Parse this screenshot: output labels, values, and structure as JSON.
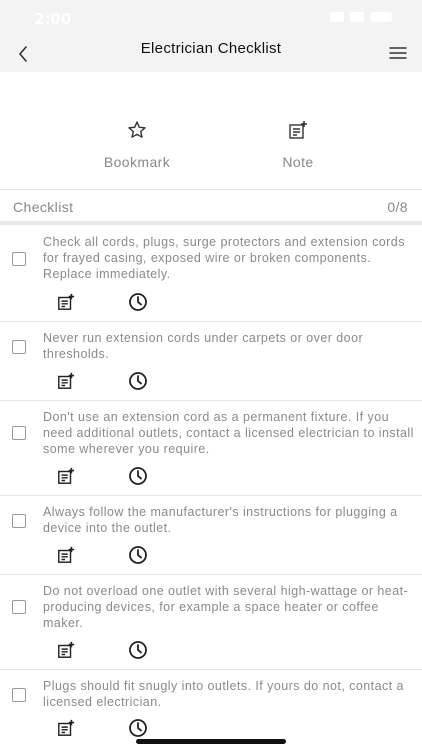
{
  "status": {
    "time": "2:00"
  },
  "nav": {
    "title": "Electrician Checklist",
    "back_icon": "chevron-left-icon",
    "menu_icon": "hamburger-menu-icon"
  },
  "actions": {
    "bookmark_label": "Bookmark",
    "note_label": "Note"
  },
  "checklist": {
    "title": "Checklist",
    "count": "0/8",
    "items": [
      {
        "text": "Check all cords, plugs, surge protectors and extension cords for frayed casing, exposed wire or broken components. Replace immediately.",
        "checked": false
      },
      {
        "text": "Never run extension cords under carpets or over door thresholds.",
        "checked": false
      },
      {
        "text": "Don't use an extension cord as a permanent fixture. If you need additional outlets, contact a licensed electrician to install some wherever you require.",
        "checked": false
      },
      {
        "text": "Always follow the manufacturer's instructions for plugging a device into the outlet.",
        "checked": false
      },
      {
        "text": "Do not overload one outlet with several high-wattage or heat-producing devices, for example a space heater or coffee maker.",
        "checked": false
      },
      {
        "text": "Plugs should fit snugly into outlets. If yours do not, contact a licensed electrician.",
        "checked": false
      }
    ]
  }
}
